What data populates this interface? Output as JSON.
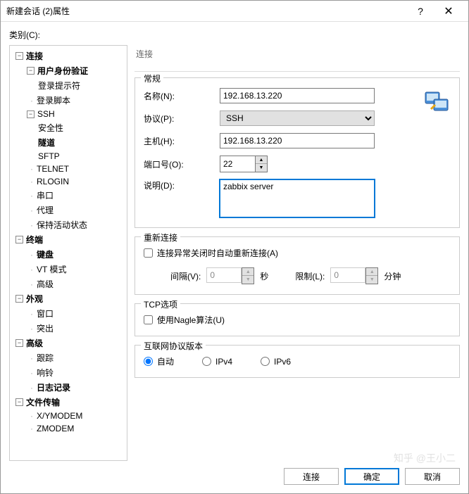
{
  "titlebar": {
    "title": "新建会话 (2)属性",
    "help": "?",
    "close": "✕"
  },
  "category_label": "类别(C):",
  "tree": {
    "connection": "连接",
    "auth": "用户身份验证",
    "login_prompt": "登录提示符",
    "login_script": "登录脚本",
    "ssh": "SSH",
    "security": "安全性",
    "tunnel": "隧道",
    "sftp": "SFTP",
    "telnet": "TELNET",
    "rlogin": "RLOGIN",
    "serial": "串口",
    "proxy": "代理",
    "keepalive": "保持活动状态",
    "terminal": "终端",
    "keyboard": "键盘",
    "vtmode": "VT 模式",
    "advanced_term": "高级",
    "appearance": "外观",
    "window": "窗口",
    "highlight": "突出",
    "advanced": "高级",
    "trace": "跟踪",
    "bell": "响铃",
    "logging": "日志记录",
    "filetransfer": "文件传输",
    "xymodem": "X/YMODEM",
    "zmodem": "ZMODEM"
  },
  "section_title": "连接",
  "general": {
    "legend": "常规",
    "name_label": "名称(N):",
    "name_value": "192.168.13.220",
    "protocol_label": "协议(P):",
    "protocol_value": "SSH",
    "host_label": "主机(H):",
    "host_value": "192.168.13.220",
    "port_label": "端口号(O):",
    "port_value": "22",
    "desc_label": "说明(D):",
    "desc_value": "zabbix server"
  },
  "reconnect": {
    "legend": "重新连接",
    "checkbox_label": "连接异常关闭时自动重新连接(A)",
    "interval_label": "间隔(V):",
    "interval_value": "0",
    "interval_unit": "秒",
    "limit_label": "限制(L):",
    "limit_value": "0",
    "limit_unit": "分钟"
  },
  "tcp": {
    "legend": "TCP选项",
    "nagle_label": "使用Nagle算法(U)"
  },
  "ipver": {
    "legend": "互联网协议版本",
    "auto": "自动",
    "ipv4": "IPv4",
    "ipv6": "IPv6"
  },
  "buttons": {
    "connect": "连接",
    "ok": "确定",
    "cancel": "取消"
  },
  "watermark": "知乎 @王小二"
}
